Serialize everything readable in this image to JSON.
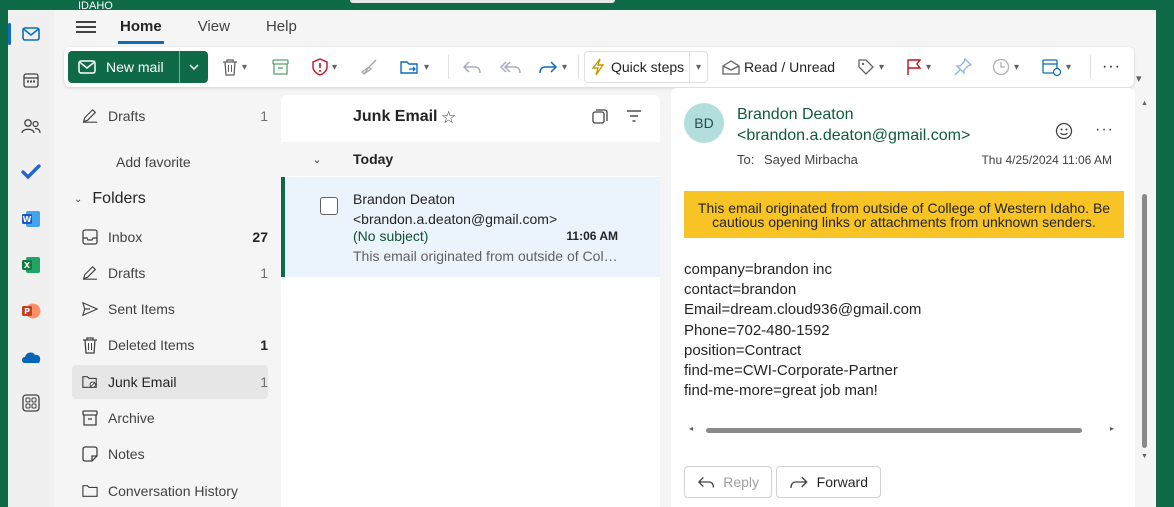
{
  "colors": {
    "brand_green": "#0f6b47",
    "accent_blue": "#0f6cbd",
    "banner_yellow": "#f7c325",
    "selected_row": "#ebf3fc",
    "avatar_bg": "#b3dede"
  },
  "header": {
    "logo_text": "IDAHO"
  },
  "rail": {
    "items": [
      "mail-icon",
      "calendar-icon",
      "people-icon",
      "todo-icon",
      "word-icon",
      "excel-icon",
      "powerpoint-icon",
      "onedrive-icon",
      "apps-icon"
    ]
  },
  "ribbon": {
    "tabs": [
      {
        "label": "Home",
        "active": true
      },
      {
        "label": "View"
      },
      {
        "label": "Help"
      }
    ],
    "new_mail": "New mail",
    "quick_steps": "Quick steps",
    "read_unread": "Read / Unread"
  },
  "folders": {
    "favorites": [
      {
        "label": "Drafts",
        "count": "1"
      }
    ],
    "add_favorite": "Add favorite",
    "section_title": "Folders",
    "items": [
      {
        "label": "Inbox",
        "count": "27",
        "bold": true
      },
      {
        "label": "Drafts",
        "count": "1"
      },
      {
        "label": "Sent Items",
        "count": ""
      },
      {
        "label": "Deleted Items",
        "count": "1",
        "bold": true
      },
      {
        "label": "Junk Email",
        "count": "1",
        "selected": true
      },
      {
        "label": "Archive",
        "count": ""
      },
      {
        "label": "Notes",
        "count": ""
      },
      {
        "label": "Conversation History",
        "count": ""
      }
    ]
  },
  "message_list": {
    "title": "Junk Email",
    "group_label": "Today",
    "messages": [
      {
        "from_name": "Brandon Deaton",
        "from_email": "<brandon.a.deaton@gmail.com>",
        "subject": "(No subject)",
        "time": "11:06 AM",
        "preview": "This email originated from outside of College of Western Idaho."
      }
    ]
  },
  "reading_pane": {
    "avatar_initials": "BD",
    "sender_name": "Brandon Deaton",
    "sender_email": "<brandon.a.deaton@gmail.com>",
    "to_label": "To:",
    "to_name": "Sayed Mirbacha",
    "date": "Thu 4/25/2024 11:06 AM",
    "banner_line1": "This email originated from outside of College of Western Idaho. Be",
    "banner_line2": "cautious opening links or attachments from unknown senders.",
    "body_lines": [
      "company=brandon inc",
      "contact=brandon",
      "Email=dream.cloud936@gmail.com",
      "Phone=702-480-1592",
      "position=Contract",
      "find-me=CWI-Corporate-Partner",
      "find-me-more=great job man!"
    ],
    "reply_label": "Reply",
    "forward_label": "Forward"
  }
}
